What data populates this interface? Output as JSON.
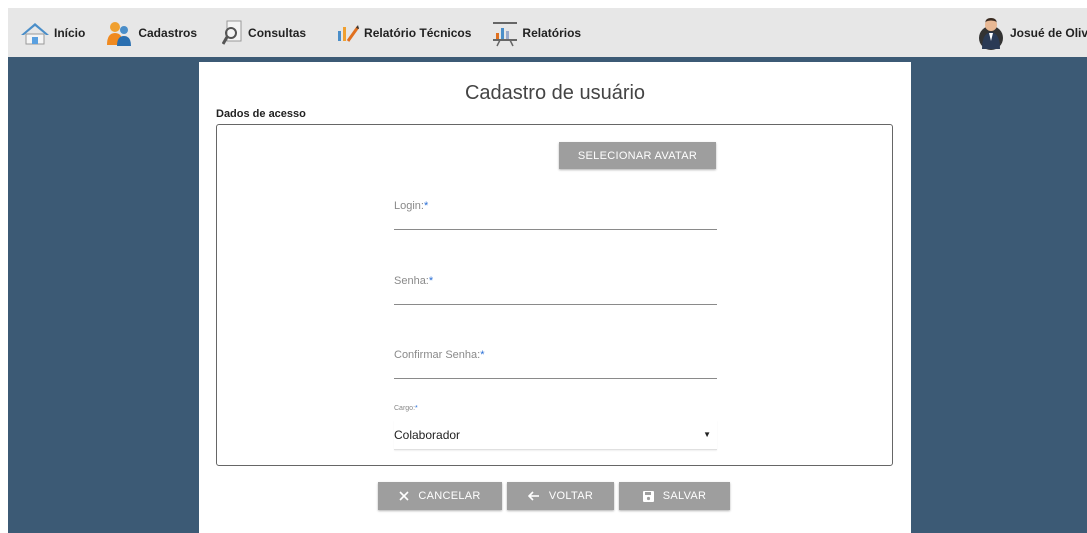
{
  "nav": {
    "items": [
      {
        "label": "Início",
        "icon": "house-icon"
      },
      {
        "label": "Cadastros",
        "icon": "people-icon"
      },
      {
        "label": "Consultas",
        "icon": "search-document-icon"
      },
      {
        "label": "Relatório Técnicos",
        "icon": "edit-chart-icon"
      },
      {
        "label": "Relatórios",
        "icon": "presentation-chart-icon"
      }
    ],
    "user_name": "Josué de Oliveira"
  },
  "page": {
    "title": "Cadastro de usuário",
    "section_label": "Dados de acesso",
    "avatar_button": "SELECIONAR AVATAR"
  },
  "form": {
    "login_label": "Login:",
    "password_label": "Senha:",
    "confirm_label": "Confirmar Senha:",
    "required_mark": "*",
    "cargo_label": "Cargo:",
    "cargo_value": "Colaborador",
    "login_value": "",
    "password_value": "",
    "confirm_value": ""
  },
  "actions": {
    "cancel": "CANCELAR",
    "back": "VOLTAR",
    "save": "SALVAR"
  },
  "colors": {
    "background": "#3c5a75",
    "navbar": "#e7e7e7",
    "button": "#9e9e9e",
    "required": "#2a6fd6"
  }
}
